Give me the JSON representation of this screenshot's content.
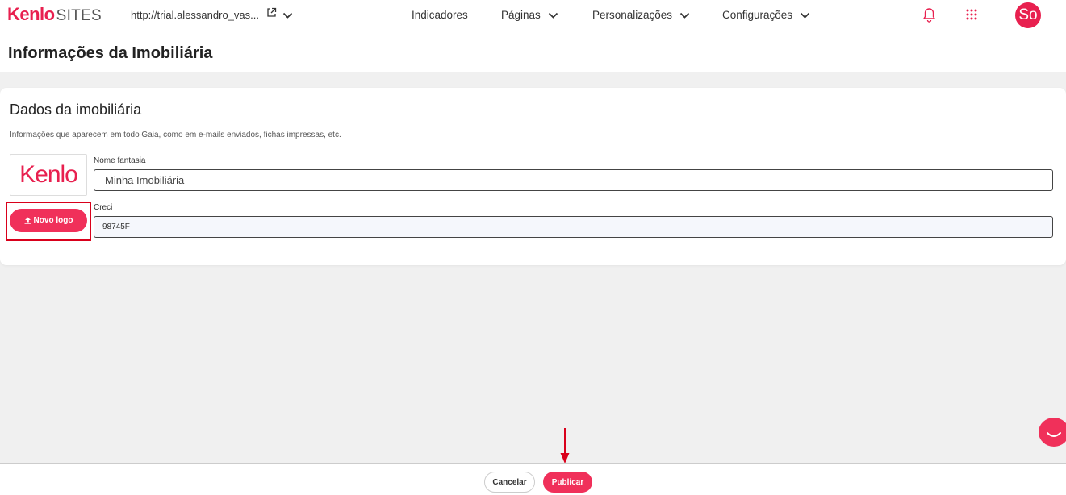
{
  "header": {
    "brand_kenlo": "Kenlo",
    "brand_sites": "SITES",
    "site_url": "http://trial.alessandro_vas...",
    "nav": {
      "indicadores": "Indicadores",
      "paginas": "Páginas",
      "personalizacoes": "Personalizações",
      "configuracoes": "Configurações"
    },
    "avatar_initials": "So",
    "icons": [
      "external-link-icon",
      "chevron-down-icon",
      "bell-icon",
      "apps-grid-icon"
    ]
  },
  "page": {
    "title": "Informações da Imobiliária"
  },
  "card": {
    "title": "Dados da imobiliária",
    "subtitle": "Informações que aparecem em todo Gaia, como em e-mails enviados, fichas impressas, etc.",
    "logo_text": "Kenlo",
    "upload_button": "Novo logo",
    "nome_fantasia": {
      "label": "Nome fantasia",
      "value": "Minha Imobiliária"
    },
    "creci": {
      "label": "Creci",
      "value": "98745F"
    }
  },
  "footer": {
    "cancel_label": "Cancelar",
    "publish_label": "Publicar"
  },
  "colors": {
    "accent": "#f0305a",
    "brand": "#e8204f",
    "annotation": "#d9001b",
    "background": "#f0f0f0"
  }
}
